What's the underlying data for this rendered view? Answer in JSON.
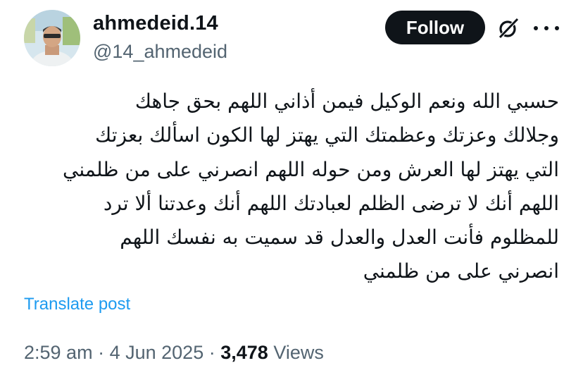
{
  "author": {
    "display_name": "ahmedeid.14",
    "handle": "@14_ahmedeid",
    "avatar_icon": "profile-photo"
  },
  "actions": {
    "follow_label": "Follow",
    "grok_icon": "grok-icon",
    "more_icon": "more-icon"
  },
  "post": {
    "lines": [
      "حسبي الله ونعم الوكيل فيمن أذاني اللهم بحق جاهك",
      "وجلالك وعزتك وعظمتك التي يهتز لها الكون اسألك بعزتك",
      "التي يهتز لها العرش ومن حوله اللهم انصرني على من ظلمني",
      "اللهم أنك لا ترضى الظلم لعبادتك اللهم أنك وعدتنا ألا ترد",
      "للمظلوم فأنت العدل والعدل قد سميت به نفسك اللهم",
      "انصرني على من ظلمني"
    ],
    "translate_label": "Translate post"
  },
  "meta": {
    "time": "2:59 am",
    "separator": "·",
    "date": "4 Jun 2025",
    "views_count": "3,478",
    "views_label": "Views"
  },
  "colors": {
    "text": "#0f1419",
    "secondary": "#536471",
    "link": "#1d9bf0",
    "button_bg": "#0f1419"
  }
}
